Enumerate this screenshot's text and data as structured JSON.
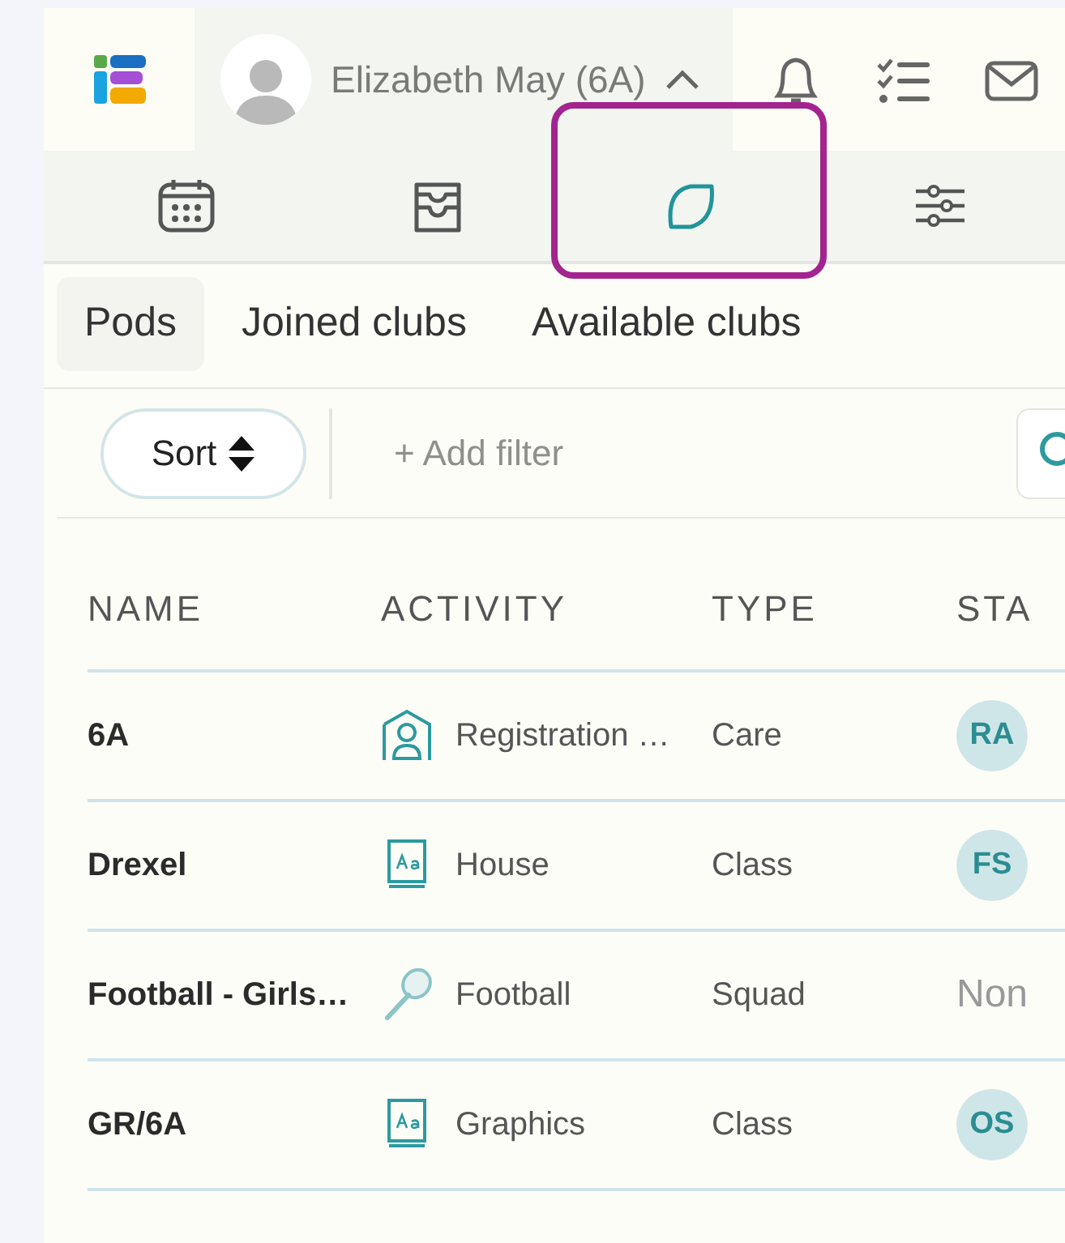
{
  "header": {
    "user_name": "Elizabeth May (6A)",
    "menu_expanded": true
  },
  "nav": [
    {
      "kind": "calendar",
      "selected": false
    },
    {
      "kind": "inbox",
      "selected": false
    },
    {
      "kind": "leaf",
      "selected": true
    },
    {
      "kind": "sliders",
      "selected": false
    }
  ],
  "tabs": [
    {
      "label": "Pods",
      "selected": true
    },
    {
      "label": "Joined clubs",
      "selected": false
    },
    {
      "label": "Available clubs",
      "selected": false
    }
  ],
  "toolbar": {
    "sort_label": "Sort",
    "filter_placeholder": "+ Add filter"
  },
  "table": {
    "columns": [
      "NAME",
      "ACTIVITY",
      "TYPE",
      "STA"
    ],
    "rows": [
      {
        "name": "6A",
        "activity": {
          "kind": "registration",
          "label": "Registration …"
        },
        "type": "Care",
        "staff": {
          "kind": "initials",
          "text": "RA"
        }
      },
      {
        "name": "Drexel",
        "activity": {
          "kind": "book",
          "label": "House"
        },
        "type": "Class",
        "staff": {
          "kind": "initials",
          "text": "FS"
        }
      },
      {
        "name": "Football - Girls…",
        "activity": {
          "kind": "racket",
          "label": "Football"
        },
        "type": "Squad",
        "staff": {
          "kind": "none",
          "text": "Non"
        }
      },
      {
        "name": "GR/6A",
        "activity": {
          "kind": "book",
          "label": "Graphics"
        },
        "type": "Class",
        "staff": {
          "kind": "initials",
          "text": "OS"
        }
      }
    ]
  }
}
